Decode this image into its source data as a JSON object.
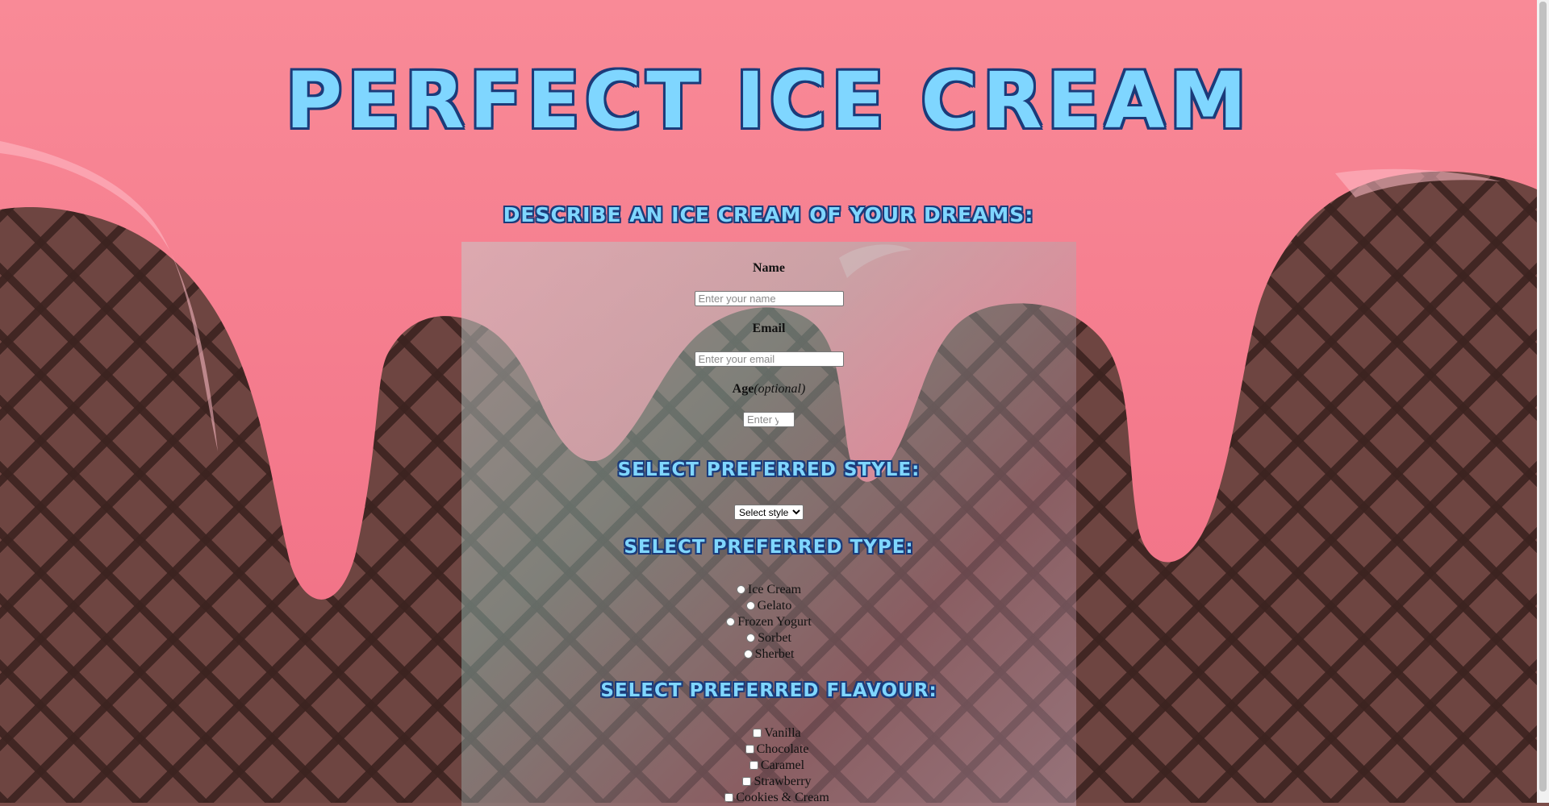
{
  "page": {
    "title": "Perfect Ice Cream",
    "form_heading": "Describe an ice cream of your dreams:"
  },
  "fields": {
    "name": {
      "label": "Name",
      "placeholder": "Enter your name"
    },
    "email": {
      "label": "Email",
      "placeholder": "Enter your email"
    },
    "age": {
      "label": "Age",
      "note": "(optional)",
      "placeholder": "Enter y"
    }
  },
  "style_section": {
    "heading": "Select preferred style:",
    "select_value": "Select style"
  },
  "type_section": {
    "heading": "Select preferred type:",
    "options": [
      "Ice Cream",
      "Gelato",
      "Frozen Yogurt",
      "Sorbet",
      "Sherbet"
    ]
  },
  "flavour_section": {
    "heading": "Select preferred flavour:",
    "options": [
      "Vanilla",
      "Chocolate",
      "Caramel",
      "Strawberry",
      "Cookies & Cream"
    ]
  },
  "colors": {
    "drip_pink": "#f47f8e",
    "heading_blue": "#7fd6ff",
    "heading_outline": "#1b3b7a",
    "waffle_brown": "#6e4541"
  }
}
